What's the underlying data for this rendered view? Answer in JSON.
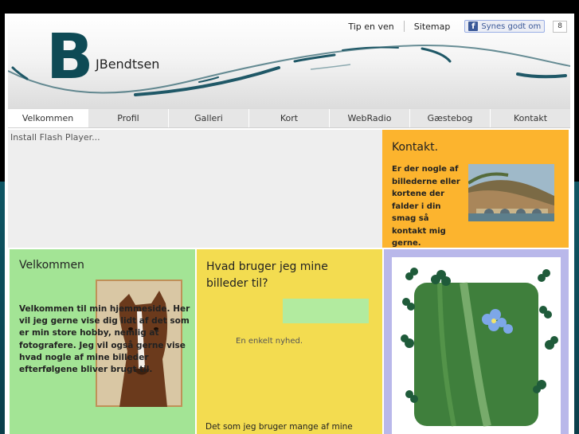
{
  "header": {
    "logo_letter": "B",
    "site_name": "JBendtsen",
    "links": [
      "Tip en ven",
      "Sitemap"
    ],
    "facebook": {
      "label": "Synes godt om",
      "count": "8"
    }
  },
  "nav": {
    "items": [
      "Velkommen",
      "Profil",
      "Galleri",
      "Kort",
      "WebRadio",
      "Gæstebog",
      "Kontakt"
    ],
    "active_index": 0
  },
  "flash": {
    "text": "Install Flash Player..."
  },
  "kontakt": {
    "title": "Kontakt.",
    "text": "Er der nogle af billederne eller kortene der falder i din smag så kontakt mig gerne."
  },
  "velkommen": {
    "title": "Velkommen",
    "text": "Velkommen til min hjemmeside. Her vil jeg gerne vise dig lidt af det som er min store hobby, nemlig at fotografere. Jeg vil også gerne vise hvad nogle af mine billeder efterfølgene bliver brugt til."
  },
  "hvad": {
    "title": "Hvad bruger jeg mine billeder til?",
    "news": "En enkelt nyhed.",
    "bottom_text": "Det som jeg bruger mange af mine"
  },
  "colors": {
    "kontakt_bg": "#fcb42e",
    "velkommen_bg": "#a3e495",
    "hvad_bg": "#f3dc50",
    "flower_bg": "#b9b8ea",
    "logo": "#0e4a55"
  }
}
